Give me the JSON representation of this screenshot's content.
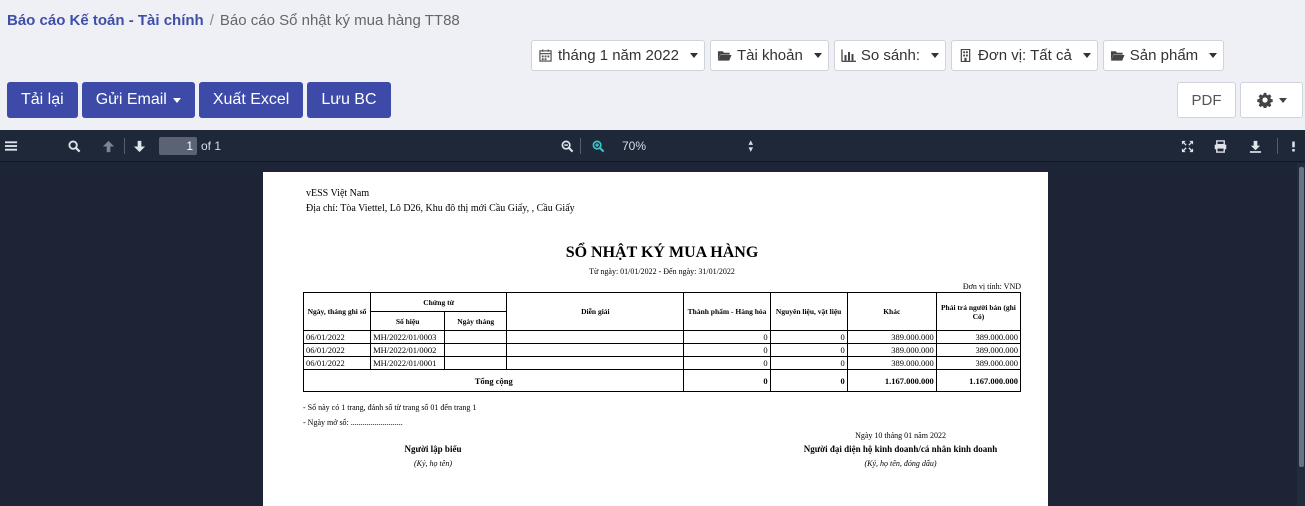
{
  "breadcrumb": {
    "parent": "Báo cáo Kế toán - Tài chính",
    "separator": "/",
    "current": "Báo cáo Sổ nhật ký mua hàng TT88"
  },
  "filters": {
    "month": "tháng 1 năm 2022",
    "account": "Tài khoản",
    "compare": "So sánh:",
    "unit": "Đơn vị: Tất cả",
    "product": "Sản phẩm"
  },
  "actions": {
    "reload": "Tải lại",
    "send_email": "Gửi Email",
    "export_excel": "Xuất Excel",
    "save": "Lưu BC",
    "pdf": "PDF"
  },
  "viewer": {
    "page_number": "1",
    "page_total": "of 1",
    "zoom": "70%"
  },
  "report": {
    "company": "vESS Việt Nam",
    "address": "Địa chỉ: Tòa Viettel, Lô D26, Khu đô thị mới Cầu Giấy, , Cầu Giấy",
    "title": "SỔ NHẬT KÝ MUA HÀNG",
    "period": "Từ ngày: 01/01/2022 - Đến ngày: 31/01/2022",
    "unit": "Đơn vị tính: VND",
    "headers": {
      "date": "Ngày, tháng ghi sổ",
      "voucher": "Chứng từ",
      "voucher_no": "Số hiệu",
      "voucher_date": "Ngày tháng",
      "description": "Diễn giải",
      "goods": "Thành phẩm - Hàng hóa",
      "materials": "Nguyên liệu, vật liệu",
      "other": "Khác",
      "payable": "Phải trả người bán (ghi Có)"
    },
    "rows": [
      {
        "date": "06/01/2022",
        "voucher_no": "MH/2022/01/0003",
        "voucher_date": "",
        "description": "",
        "goods": "0",
        "materials": "0",
        "other": "389.000.000",
        "payable": "389.000.000"
      },
      {
        "date": "06/01/2022",
        "voucher_no": "MH/2022/01/0002",
        "voucher_date": "",
        "description": "",
        "goods": "0",
        "materials": "0",
        "other": "389.000.000",
        "payable": "389.000.000"
      },
      {
        "date": "06/01/2022",
        "voucher_no": "MH/2022/01/0001",
        "voucher_date": "",
        "description": "",
        "goods": "0",
        "materials": "0",
        "other": "389.000.000",
        "payable": "389.000.000"
      }
    ],
    "total": {
      "label": "Tổng cộng",
      "goods": "0",
      "materials": "0",
      "other": "1.167.000.000",
      "payable": "1.167.000.000"
    },
    "note_pages": "- Sổ này có 1 trang, đánh số từ trang số 01 đến trang 1",
    "note_open_date": "- Ngày mở sổ: ..........................",
    "sign_date": "Ngày 10 tháng 01 năm 2022",
    "preparer": "Người lập biểu",
    "preparer_sub": "(Ký, họ tên)",
    "representative": "Người đại diện hộ kinh doanh/cá nhân kinh doanh",
    "representative_sub": "(Ký, họ tên, đóng dấu)"
  }
}
